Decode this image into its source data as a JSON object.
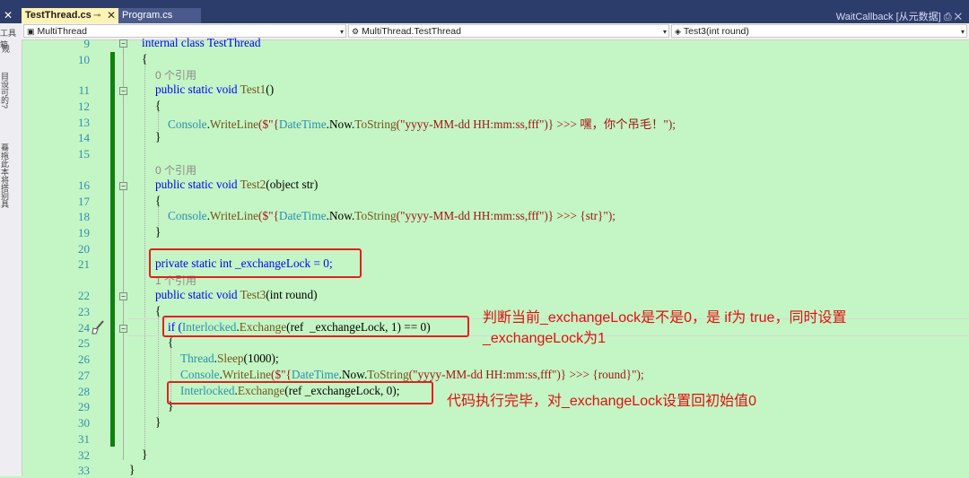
{
  "tabs": {
    "active_label": "TestThread.cs",
    "pin_glyph": "⊸",
    "close_glyph": "✕",
    "second_label": "Program.cs",
    "right_label": "WaitCallback [从元数据] ⎙ ✕"
  },
  "left_panel": {
    "close_glyph": "✕",
    "title": "工具箱",
    "item": "规",
    "vertical_text_1": "目设可的?",
    "vertical_text_2": "蓦拖此本将搭别具"
  },
  "nav": {
    "project": "MultiThread",
    "class": "MultiThread.TestThread",
    "member": "Test3(int round)"
  },
  "line_numbers": [
    "9",
    "10",
    "11",
    "12",
    "13",
    "14",
    "15",
    "16",
    "17",
    "18",
    "19",
    "20",
    "21",
    "22",
    "23",
    "24",
    "25",
    "26",
    "27",
    "28",
    "29",
    "30",
    "31",
    "32",
    "33"
  ],
  "code": {
    "l9": "internal class TestThread",
    "l10": "{",
    "ref_a": "0 个引用",
    "l11_a": "public static void ",
    "l11_b": "Test1",
    "l11_c": "()",
    "l12": "{",
    "l13_a": "Console",
    "l13_b": ".",
    "l13_c": "WriteLine",
    "l13_d": "($\"{",
    "l13_e": "DateTime",
    "l13_f": ".Now.",
    "l13_g": "ToString",
    "l13_h": "(\"yyyy-MM-dd HH:mm:ss,fff\")} >>> 嘿，你个吊毛！\");",
    "l14": "}",
    "ref_b": "0 个引用",
    "l16_a": "public static void ",
    "l16_b": "Test2",
    "l16_c": "(object str)",
    "l17": "{",
    "l18_a": "Console",
    "l18_b": ".",
    "l18_c": "WriteLine",
    "l18_d": "($\"{",
    "l18_e": "DateTime",
    "l18_f": ".Now.",
    "l18_g": "ToString",
    "l18_h": "(\"yyyy-MM-dd HH:mm:ss,fff\")} >>> {str}\");",
    "l19": "}",
    "l21": "private static int _exchangeLock = 0;",
    "ref_c": "1 个引用",
    "l22_a": "public static void ",
    "l22_b": "Test3",
    "l22_c": "(int round)",
    "l23": "{",
    "l24_a": "if (",
    "l24_b": "Interlocked",
    "l24_c": ".",
    "l24_d": "Exchange",
    "l24_e": "(ref  _exchangeLock, 1) == 0)",
    "l25": "{",
    "l26_a": "Thread",
    "l26_b": ".",
    "l26_c": "Sleep",
    "l26_d": "(1000);",
    "l27_a": "Console",
    "l27_b": ".",
    "l27_c": "WriteLine",
    "l27_d": "($\"{",
    "l27_e": "DateTime",
    "l27_f": ".Now.",
    "l27_g": "ToString",
    "l27_h": "(\"yyyy-MM-dd HH:mm:ss,fff\")} >>> {round}\");",
    "l28_a": "Interlocked",
    "l28_b": ".",
    "l28_c": "Exchange",
    "l28_d": "(ref _exchangeLock, 0);",
    "l29": "}",
    "l30": "}",
    "l32": "}",
    "l33": "}"
  },
  "annotations": {
    "a1_line1": "判断当前_exchangeLock是不是0，是 if为 true，同时设置",
    "a1_line2": "_exchangeLock为1",
    "a2": "代码执行完毕，对_exchangeLock设置回初始值0"
  },
  "colors": {
    "editor_bg": "#c4f5c4",
    "keyword": "#0000ff",
    "type": "#2b91af",
    "method": "#74531f",
    "string": "#a31515",
    "annotation": "#e01010"
  }
}
